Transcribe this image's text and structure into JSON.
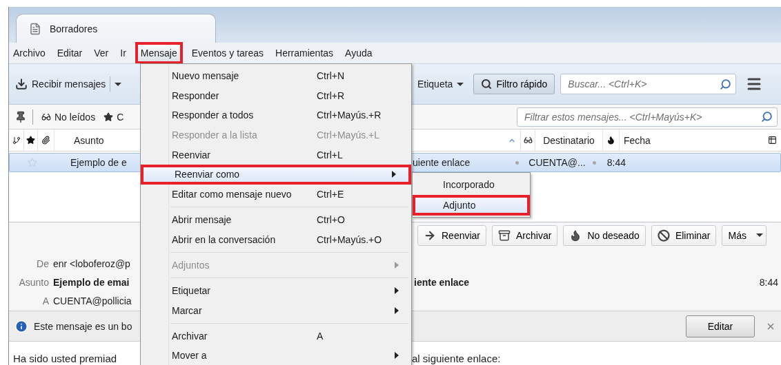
{
  "tab": {
    "title": "Borradores"
  },
  "menubar": [
    {
      "label": "Archivo",
      "selected": false,
      "highlighted": false
    },
    {
      "label": "Editar",
      "selected": false,
      "highlighted": false
    },
    {
      "label": "Ver",
      "selected": false,
      "highlighted": false
    },
    {
      "label": "Ir",
      "selected": false,
      "highlighted": false
    },
    {
      "label": "Mensaje",
      "selected": true,
      "highlighted": true
    },
    {
      "label": "Eventos y tareas",
      "selected": false,
      "highlighted": false
    },
    {
      "label": "Herramientas",
      "selected": false,
      "highlighted": false
    },
    {
      "label": "Ayuda",
      "selected": false,
      "highlighted": false
    }
  ],
  "toolbar": {
    "get_messages": "Recibir mensajes",
    "tag": "Etiqueta",
    "quick_filter": "Filtro rápido",
    "search": {
      "placeholder": "Buscar... <Ctrl+K>"
    }
  },
  "filter_bar": {
    "unread": "No leídos",
    "starred": "C",
    "filter": {
      "placeholder": "Filtrar estos mensajes... <Ctrl+Mayús+K>"
    }
  },
  "columns": {
    "subject": "Asunto",
    "recipient": "Destinatario",
    "date": "Fecha"
  },
  "messages": [
    {
      "subject_start": "Ejemplo de e",
      "subject_end": "uiente enlace",
      "recipient": "CUENTA@...",
      "date": "8:44",
      "selected": true,
      "starred": false
    }
  ],
  "message_actions": [
    {
      "kind": "forward",
      "label": "Reenviar"
    },
    {
      "kind": "archive",
      "label": "Archivar"
    },
    {
      "kind": "junk",
      "label": "No deseado"
    },
    {
      "kind": "delete",
      "label": "Eliminar"
    },
    {
      "kind": "more",
      "label": "Más"
    }
  ],
  "header": {
    "from_label": "De",
    "from": "enr <loboferoz@p",
    "subject_label": "Asunto",
    "subject_start": "Ejemplo de emai",
    "subject_end": "iente enlace",
    "time": "8:44",
    "to_label": "A",
    "to": "CUENTA@pollicia"
  },
  "notification": {
    "text": "Este mensaje es un bo",
    "button": "Editar"
  },
  "body": {
    "start": "Ha sido usted premiad",
    "end": "al siguiente enlace:"
  },
  "menu": [
    {
      "kind": "item",
      "label": "Nuevo mensaje",
      "shortcut": "Ctrl+N",
      "disabled": false,
      "selected": false,
      "highlighted": false
    },
    {
      "kind": "item",
      "label": "Responder",
      "shortcut": "Ctrl+R",
      "disabled": false,
      "selected": false,
      "highlighted": false
    },
    {
      "kind": "item",
      "label": "Responder a todos",
      "shortcut": "Ctrl+Mayús.+R",
      "disabled": false,
      "selected": false,
      "highlighted": false
    },
    {
      "kind": "item",
      "label": "Responder a la lista",
      "shortcut": "Ctrl+Mayús.+L",
      "disabled": true,
      "selected": false,
      "highlighted": false
    },
    {
      "kind": "item",
      "label": "Reenviar",
      "shortcut": "Ctrl+L",
      "disabled": false,
      "selected": false,
      "highlighted": false
    },
    {
      "kind": "submenu",
      "label": "Reenviar como",
      "disabled": false,
      "selected": true,
      "highlighted": true
    },
    {
      "kind": "item",
      "label": "Editar como mensaje nuevo",
      "shortcut": "Ctrl+E",
      "disabled": false,
      "selected": false,
      "highlighted": false
    },
    {
      "kind": "separator"
    },
    {
      "kind": "item",
      "label": "Abrir mensaje",
      "shortcut": "Ctrl+O",
      "disabled": false,
      "selected": false,
      "highlighted": false
    },
    {
      "kind": "item",
      "label": "Abrir en la conversación",
      "shortcut": "Ctrl+Mayús.+O",
      "disabled": false,
      "selected": false,
      "highlighted": false
    },
    {
      "kind": "separator"
    },
    {
      "kind": "submenu",
      "label": "Adjuntos",
      "disabled": true,
      "selected": false,
      "highlighted": false
    },
    {
      "kind": "separator"
    },
    {
      "kind": "submenu",
      "label": "Etiquetar",
      "disabled": false,
      "selected": false,
      "highlighted": false
    },
    {
      "kind": "submenu",
      "label": "Marcar",
      "disabled": false,
      "selected": false,
      "highlighted": false
    },
    {
      "kind": "separator"
    },
    {
      "kind": "item",
      "label": "Archivar",
      "shortcut": "A",
      "disabled": false,
      "selected": false,
      "highlighted": false
    },
    {
      "kind": "submenu",
      "label": "Mover a",
      "disabled": false,
      "selected": false,
      "highlighted": false
    }
  ],
  "submenu": [
    {
      "label": "Incorporado",
      "selected": false,
      "highlighted": false
    },
    {
      "label": "Adjunto",
      "selected": true,
      "highlighted": true
    }
  ]
}
